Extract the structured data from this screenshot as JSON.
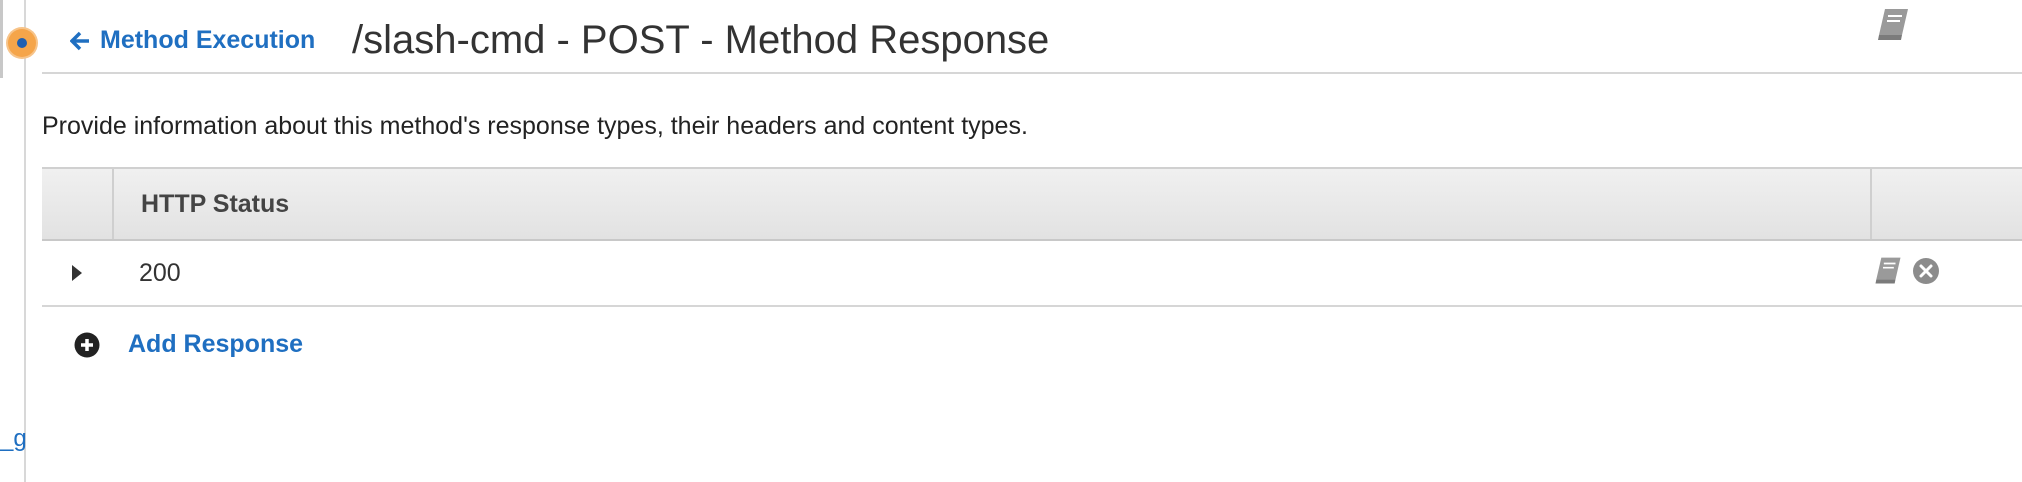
{
  "header": {
    "back_label": "Method Execution",
    "title": "/slash-cmd - POST - Method Response"
  },
  "description": "Provide information about this method's response types, their headers and content types.",
  "table": {
    "columns": [
      "HTTP Status"
    ],
    "rows": [
      {
        "status": "200"
      }
    ]
  },
  "add_response_label": "Add Response",
  "left_rail_text": "_g",
  "colors": {
    "link": "#1f6fc1",
    "accent_orange": "#f5a54a"
  },
  "icons": [
    "arrow-left-icon",
    "book-icon",
    "caret-right-icon",
    "close-circle-icon",
    "plus-circle-icon"
  ]
}
